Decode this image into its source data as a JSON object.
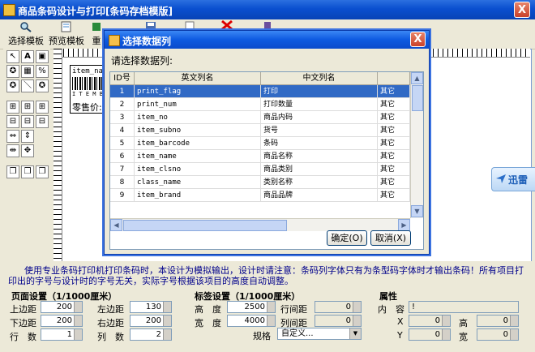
{
  "app": {
    "title": "商品条码设计与打印[条码存档模版]",
    "close_glyph": "X"
  },
  "toolbar": {
    "items": [
      {
        "label": "选择模板",
        "icon": "magnifier-icon"
      },
      {
        "label": "预览模板",
        "icon": "preview-icon"
      },
      {
        "label": "重",
        "icon": "refresh-icon"
      }
    ]
  },
  "canvas": {
    "preview_line": "item_nam",
    "preview_price_label": "零售价:",
    "preview_barcode_text": "I T E M  B"
  },
  "side_widget": {
    "label": "迅雷"
  },
  "dialog": {
    "title": "选择数据列",
    "close_glyph": "X",
    "prompt": "请选择数据列:",
    "columns": {
      "id": "ID号",
      "en": "英文列名",
      "cn": "中文列名"
    },
    "rows": [
      {
        "id": "1",
        "en": "print_flag",
        "cn": "打印",
        "extra": "其它"
      },
      {
        "id": "2",
        "en": "print_num",
        "cn": "打印数量",
        "extra": "其它"
      },
      {
        "id": "3",
        "en": "item_no",
        "cn": "商品内码",
        "extra": "其它"
      },
      {
        "id": "4",
        "en": "item_subno",
        "cn": "货号",
        "extra": "其它"
      },
      {
        "id": "5",
        "en": "item_barcode",
        "cn": "条码",
        "extra": "其它"
      },
      {
        "id": "6",
        "en": "item_name",
        "cn": "商品名称",
        "extra": "其它"
      },
      {
        "id": "7",
        "en": "item_clsno",
        "cn": "商品类别",
        "extra": "其它"
      },
      {
        "id": "8",
        "en": "class_name",
        "cn": "类别名称",
        "extra": "其它"
      },
      {
        "id": "9",
        "en": "item_brand",
        "cn": "商品品牌",
        "extra": "其它"
      }
    ],
    "ok_label": "确定(O)",
    "cancel_label": "取消(X)"
  },
  "bottom": {
    "info": "使用专业条码打印机打印条码时，本设计为模拟输出，设计时请注意：条码列字体只有为条型码字体时才输出条码！所有项目打印出的字号与设计时的字号无关，实际字号根据该项目的高度自动调整。",
    "page_settings": {
      "title": "页面设置（1/1000厘米）",
      "top_label": "上边距",
      "top_value": "200",
      "left_label": "左边距",
      "left_value": "130",
      "bottom_label": "下边距",
      "bottom_value": "200",
      "right_label": "右边距",
      "right_value": "200",
      "rows_label": "行　数",
      "rows_value": "1",
      "cols_label": "列　数",
      "cols_value": "2"
    },
    "label_settings": {
      "title": "标签设置（1/1000厘米）",
      "height_label": "高　度",
      "height_value": "2500",
      "row_gap_label": "行间距",
      "row_gap_value": "0",
      "width_label": "宽　度",
      "width_value": "4000",
      "col_gap_label": "列间距",
      "col_gap_value": "0",
      "spec_label": "规格",
      "spec_value": "自定义..."
    },
    "attributes": {
      "title": "属性",
      "content_label": "内　容",
      "content_value": "!",
      "x_label": "X",
      "x_value": "0",
      "h_label": "高",
      "h_value": "0",
      "y_label": "Y",
      "y_value": "0",
      "w_label": "宽",
      "w_value": "0"
    }
  }
}
